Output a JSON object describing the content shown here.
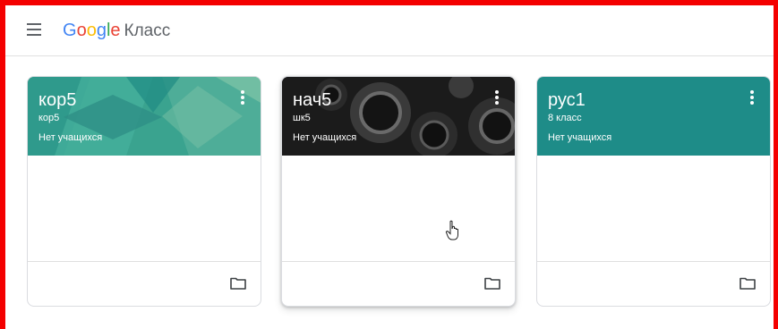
{
  "header": {
    "brand_letters": [
      "G",
      "o",
      "o",
      "g",
      "l",
      "e"
    ],
    "product": "Класс"
  },
  "colors": {
    "frame": "#f40000",
    "google_blue": "#4285f4",
    "google_red": "#ea4335",
    "google_yellow": "#fbbc05",
    "google_green": "#34a853",
    "card1_header": "#3aa38f",
    "card2_header": "#1e1e1e",
    "card3_header": "#1e8c88"
  },
  "cards": [
    {
      "title": "кор5",
      "subtitle": "кор5",
      "students": "Нет учащихся",
      "more_icon": "more-vert-icon",
      "folder_icon": "folder-icon"
    },
    {
      "title": "нач5",
      "subtitle": "шк5",
      "students": "Нет учащихся",
      "more_icon": "more-vert-icon",
      "folder_icon": "folder-icon"
    },
    {
      "title": "рус1",
      "subtitle": "8 класс",
      "students": "Нет учащихся",
      "more_icon": "more-vert-icon",
      "folder_icon": "folder-icon"
    }
  ],
  "cursor": "hand-pointer-icon"
}
